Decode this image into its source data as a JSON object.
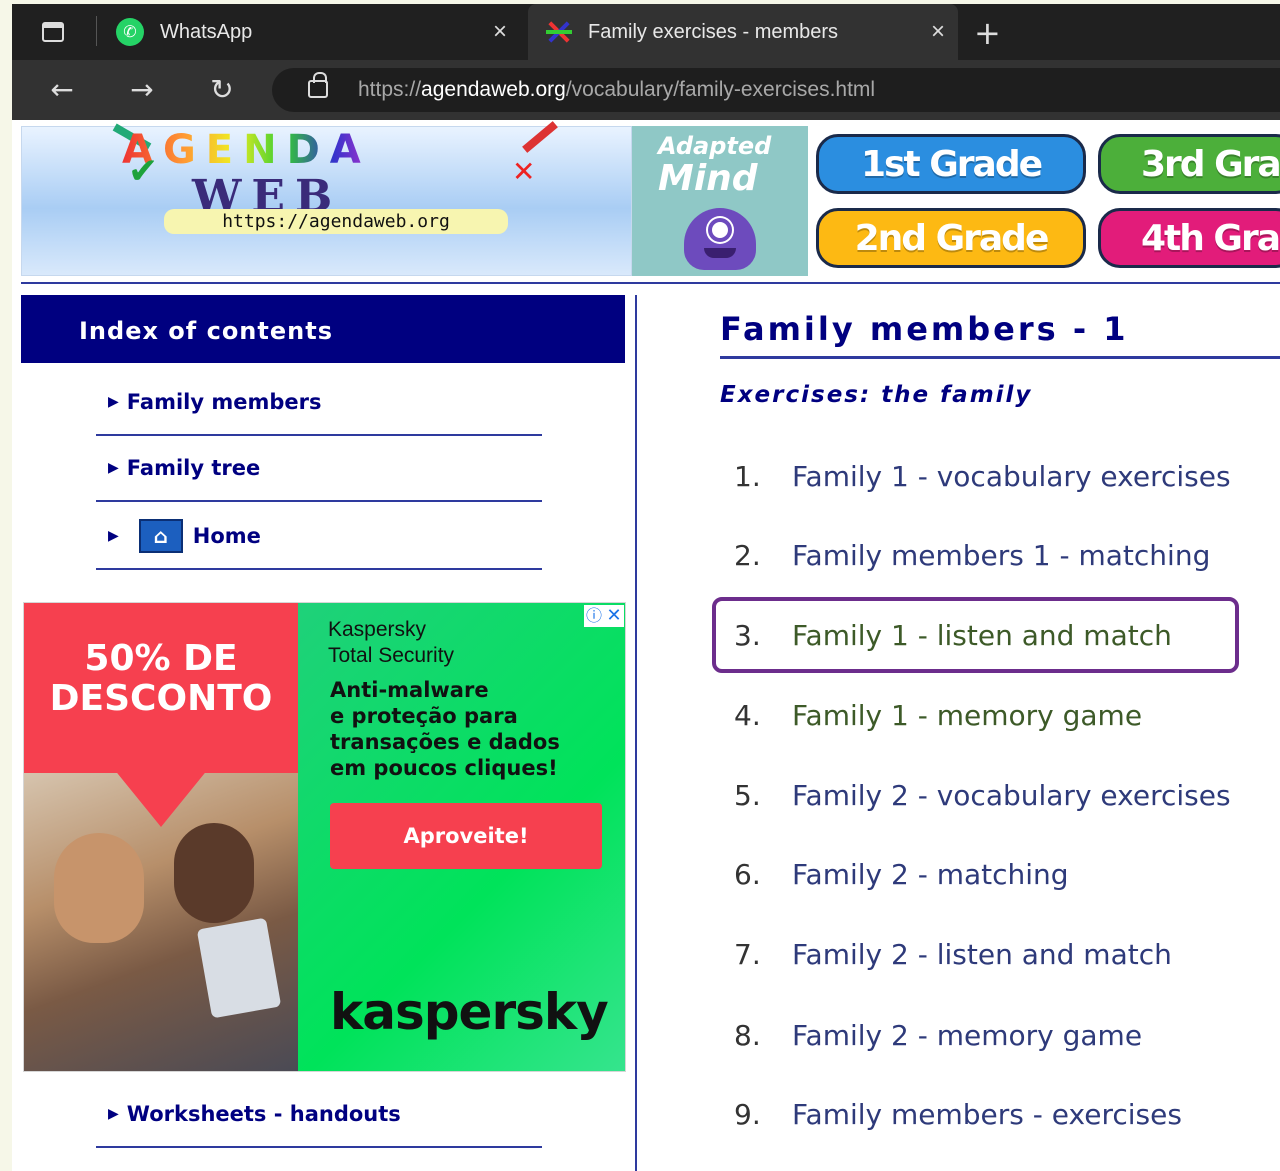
{
  "browser": {
    "tabs": [
      {
        "title": "WhatsApp",
        "icon": "whatsapp-icon",
        "active": false
      },
      {
        "title": "Family exercises - members",
        "icon": "agendaweb-favicon",
        "active": true
      }
    ],
    "url_scheme": "https://",
    "url_host": "agendaweb.org",
    "url_path": "/vocabulary/family-exercises.html"
  },
  "banner": {
    "logo_word": "WEB",
    "logo_ring": "AGENDA",
    "logo_url": "https://agendaweb.org",
    "ad_brand_line1": "Adapted",
    "ad_brand_line2": "Mind",
    "grades": [
      "1st Grade",
      "2nd Grade",
      "3rd Gra",
      "4th Gra"
    ]
  },
  "sidebar": {
    "heading": "Index of contents",
    "items": [
      {
        "label": "Family members"
      },
      {
        "label": "Family tree"
      },
      {
        "label": "Home"
      },
      {
        "label": "Worksheets - handouts"
      }
    ]
  },
  "ad": {
    "discount": "50% DE DESCONTO",
    "brand_line1": "Kaspersky",
    "brand_line2": "Total Security",
    "tagline_lines": [
      "Anti-malware",
      "e proteção para",
      "transações e dados",
      "em poucos cliques!"
    ],
    "cta": "Aproveite!",
    "logo": "kaspersky",
    "colors": {
      "red": "#f6404f",
      "green": "#00e35a"
    }
  },
  "main": {
    "title": "Family members - 1",
    "subtitle": "Exercises: the family",
    "exercises": [
      {
        "num": "1.",
        "label": "Family 1 - vocabulary exercises",
        "visited": false
      },
      {
        "num": "2.",
        "label": "Family members 1 - matching",
        "visited": false
      },
      {
        "num": "3.",
        "label": "Family 1 - listen and match",
        "visited": true,
        "highlighted": true
      },
      {
        "num": "4.",
        "label": "Family 1 - memory game",
        "visited": true
      },
      {
        "num": "5.",
        "label": "Family 2 - vocabulary exercises",
        "visited": false
      },
      {
        "num": "6.",
        "label": "Family 2 - matching",
        "visited": false
      },
      {
        "num": "7.",
        "label": "Family 2 - listen and match",
        "visited": false
      },
      {
        "num": "8.",
        "label": "Family 2 - memory game",
        "visited": false
      },
      {
        "num": "9.",
        "label": "Family members - exercises",
        "visited": false
      }
    ],
    "highlight_color": "#6c2d8c"
  }
}
